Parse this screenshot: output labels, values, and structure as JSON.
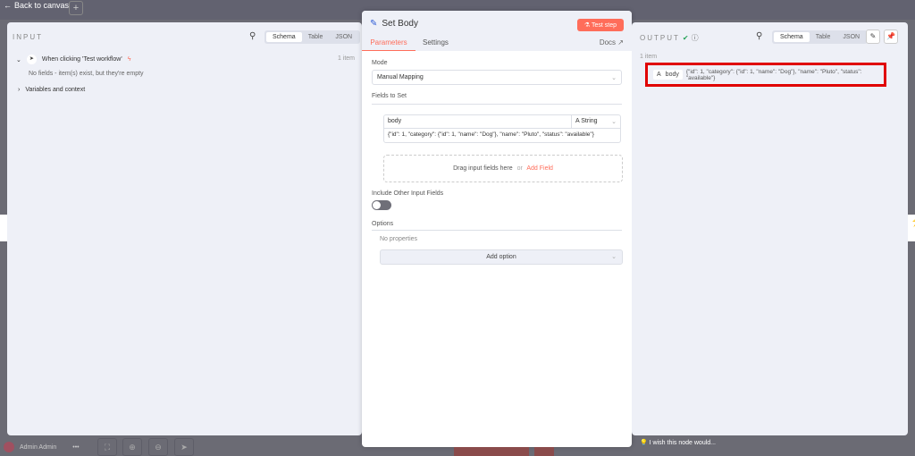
{
  "topbar": {
    "back_label": "Back to canvas",
    "add_label": "+"
  },
  "input": {
    "title": "INPUT",
    "tabs": [
      "Schema",
      "Table",
      "JSON"
    ],
    "active_tab": "Schema",
    "node": "When clicking 'Test workflow'",
    "count": "1 item",
    "empty": "No fields - item(s) exist, but they're empty",
    "variables": "Variables and context"
  },
  "node": {
    "title": "Set Body",
    "test_button": "Test step",
    "tabs": [
      "Parameters",
      "Settings"
    ],
    "active_tab": "Parameters",
    "docs": "Docs",
    "mode_label": "Mode",
    "mode_value": "Manual Mapping",
    "fields_label": "Fields to Set",
    "field_name": "body",
    "field_type": "String",
    "field_value": "{\"id\": 1, \"category\": {\"id\": 1, \"name\": \"Dog\"}, \"name\": \"Pluto\", \"status\": \"available\"}",
    "drag_text": "Drag input fields here",
    "or": "or",
    "add_field": "Add Field",
    "include_label": "Include Other Input Fields",
    "include_on": false,
    "options_label": "Options",
    "no_properties": "No properties",
    "add_option": "Add option"
  },
  "output": {
    "title": "OUTPUT",
    "tabs": [
      "Schema",
      "Table",
      "JSON"
    ],
    "active_tab": "Schema",
    "count": "1 item",
    "type_icon": "A",
    "key": "body",
    "value": "{\"id\": 1, \"category\": {\"id\": 1, \"name\": \"Dog\"}, \"name\": \"Pluto\", \"status\": \"available\"}"
  },
  "footer": {
    "user": "Admin Admin",
    "more": "•••",
    "feedback": "I wish this node would..."
  },
  "colors": {
    "accent": "#ff6d5a",
    "highlight": "#e00000",
    "success": "#29a35a"
  }
}
